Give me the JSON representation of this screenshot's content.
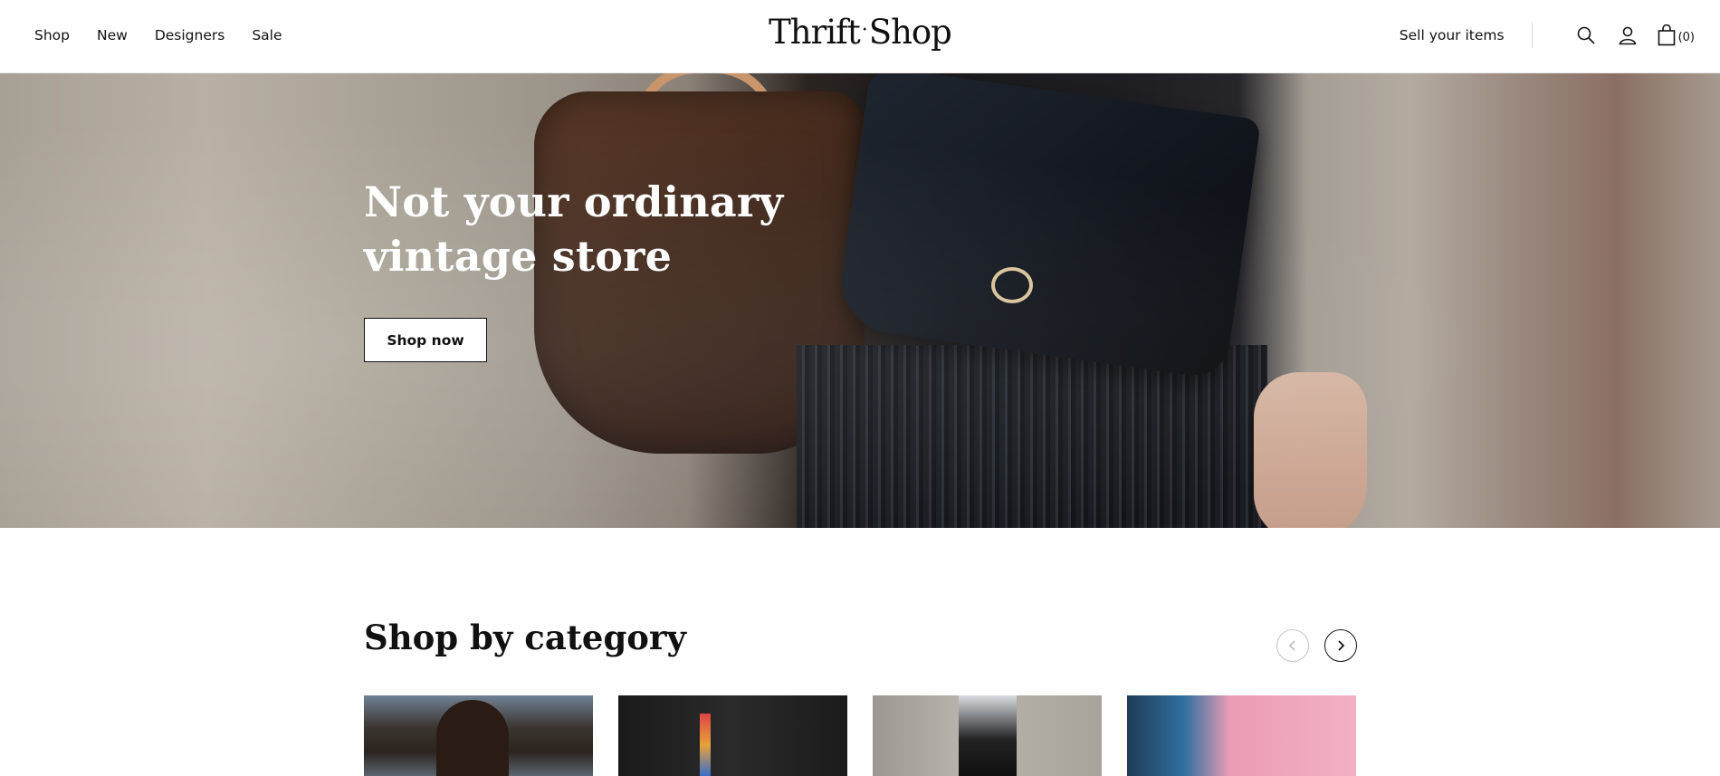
{
  "header": {
    "nav": [
      "Shop",
      "New",
      "Designers",
      "Sale"
    ],
    "logo_left": "Thrift",
    "logo_dot": "·",
    "logo_right": "Shop",
    "sell_link": "Sell your items",
    "cart_count": "(0)"
  },
  "hero": {
    "title_line1": "Not your ordinary",
    "title_line2": "vintage store",
    "cta": "Shop now"
  },
  "category": {
    "title": "Shop by category",
    "cards": 4
  },
  "icons": {
    "search": "search-icon",
    "account": "user-icon",
    "cart": "shopping-bag-icon",
    "prev": "chevron-left-icon",
    "next": "chevron-right-icon"
  },
  "colors": {
    "text": "#111111",
    "background": "#ffffff",
    "muted_border": "#c4c4c4"
  }
}
